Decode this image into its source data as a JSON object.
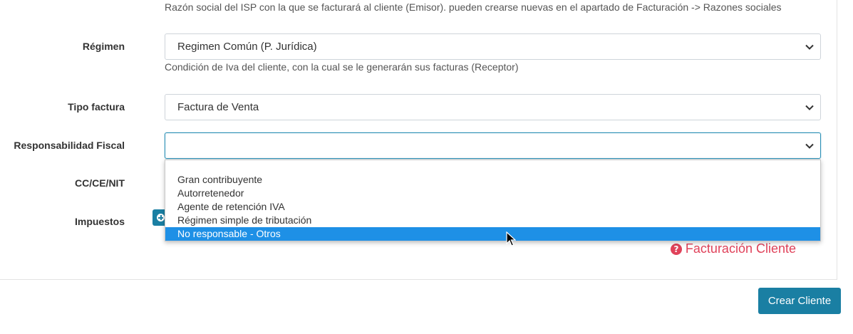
{
  "emisor": {
    "help": "Razón social del ISP con la que se facturará al cliente (Emisor). pueden crearse nuevas en el apartado de Facturación -> Razones sociales"
  },
  "regimen": {
    "label": "Régimen",
    "value": "Regimen Común (P. Jurídica)",
    "help": "Condición de Iva del cliente, con la cual se le generarán sus facturas (Receptor)"
  },
  "tipo_factura": {
    "label": "Tipo factura",
    "value": "Factura de Venta"
  },
  "responsabilidad": {
    "label": "Responsabilidad Fiscal",
    "value": "",
    "options": [
      "Gran contribuyente",
      "Autorretenedor",
      "Agente de retención IVA",
      "Régimen simple de tributación",
      "No responsable - Otros"
    ],
    "highlighted": "No responsable - Otros"
  },
  "documento": {
    "label": "CC/CE/NIT"
  },
  "impuestos": {
    "label": "Impuestos"
  },
  "links": {
    "facturacion_cliente": "Facturación Cliente"
  },
  "actions": {
    "crear_cliente": "Crear Cliente"
  },
  "colors": {
    "accent": "#1a7fa3",
    "highlight": "#1e90e6",
    "danger": "#e0425a"
  },
  "icons": {
    "chevron": "chevron-down-icon",
    "help": "question-circle-icon",
    "add": "plus-circle-icon"
  }
}
